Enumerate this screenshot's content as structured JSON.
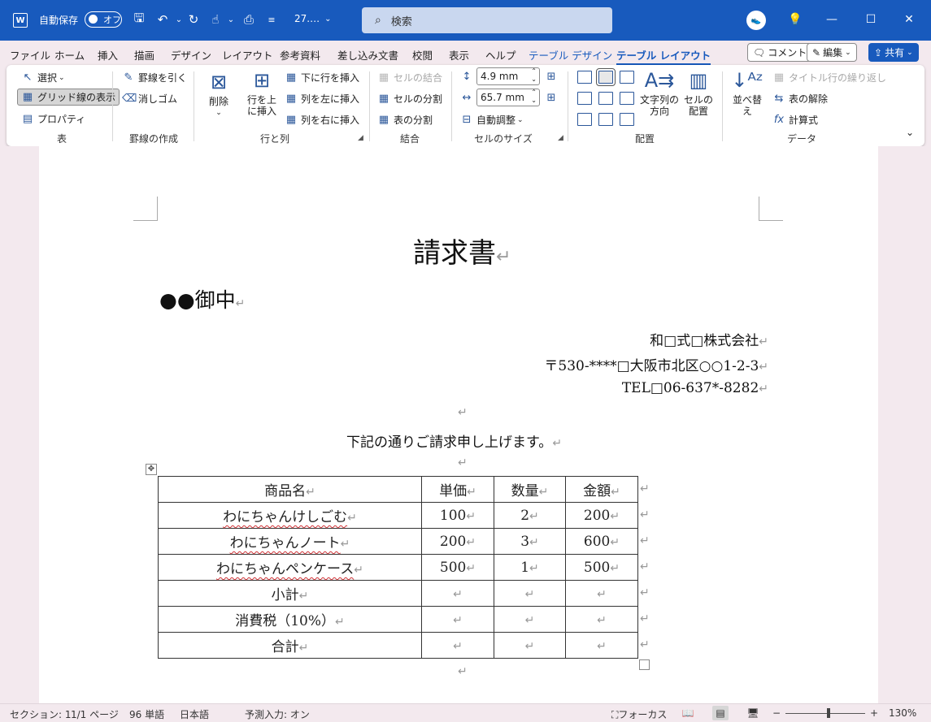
{
  "titlebar": {
    "app_logo": "W",
    "autosave_label": "自動保存",
    "autosave_state": "オフ",
    "doc_title": "27.…",
    "search_placeholder": "検索",
    "icons": [
      "save-icon",
      "undo-icon",
      "redo-icon",
      "touch-mode-icon",
      "customize-qat-icon"
    ]
  },
  "tabs": [
    {
      "label": "ファイル"
    },
    {
      "label": "ホーム"
    },
    {
      "label": "挿入"
    },
    {
      "label": "描画"
    },
    {
      "label": "デザイン"
    },
    {
      "label": "レイアウト"
    },
    {
      "label": "参考資料"
    },
    {
      "label": "差し込み文書"
    },
    {
      "label": "校閲"
    },
    {
      "label": "表示"
    },
    {
      "label": "ヘルプ"
    },
    {
      "label": "テーブル デザイン"
    },
    {
      "label": "テーブル レイアウト"
    }
  ],
  "top_buttons": {
    "comment": "コメント",
    "edit": "編集",
    "share": "共有"
  },
  "ribbon": {
    "table": {
      "select": "選択",
      "gridlines": "グリッド線の表示",
      "properties": "プロパティ",
      "label": "表"
    },
    "draw": {
      "draw_borders": "罫線を引く",
      "eraser": "消しゴム",
      "label": "罫線の作成"
    },
    "rows_cols": {
      "delete": "削除",
      "insert_above": "行を上\nに挿入",
      "insert_below": "下に行を挿入",
      "insert_left": "列を左に挿入",
      "insert_right": "列を右に挿入",
      "label": "行と列"
    },
    "merge": {
      "merge_cells": "セルの結合",
      "split_cells": "セルの分割",
      "split_table": "表の分割",
      "label": "結合"
    },
    "cell_size": {
      "height": "4.9 mm",
      "width": "65.7 mm",
      "autofit": "自動調整",
      "label": "セルのサイズ"
    },
    "alignment": {
      "text_direction": "文字列の\n方向",
      "cell_margins": "セルの\n配置",
      "label": "配置"
    },
    "data": {
      "sort": "並べ替え",
      "repeat_header": "タイトル行の繰り返し",
      "convert_to_text": "表の解除",
      "formula": "計算式",
      "label": "データ"
    }
  },
  "document": {
    "title": "請求書",
    "addressee": "●●御中",
    "company": "和□式□株式会社",
    "address": "〒530-****□大阪市北区○○1-2-3",
    "tel": "TEL□06-637*-8282",
    "intro": "下記の通りご請求申し上げます。",
    "paragraph_mark": "↵",
    "table": {
      "headers": [
        "商品名",
        "単価",
        "数量",
        "金額"
      ],
      "rows": [
        [
          "わにちゃんけしごむ",
          "100",
          "2",
          "200"
        ],
        [
          "わにちゃんノート",
          "200",
          "3",
          "600"
        ],
        [
          "わにちゃんペンケース",
          "500",
          "1",
          "500"
        ],
        [
          "小計",
          "",
          "",
          ""
        ],
        [
          "消費税（10%）",
          "",
          "",
          ""
        ],
        [
          "合計",
          "",
          "",
          ""
        ]
      ]
    }
  },
  "statusbar": {
    "section": "セクション: 1",
    "page": "1/1 ページ",
    "words": "96 単語",
    "language": "日本語",
    "predictive": "予測入力: オン",
    "focus": "フォーカス",
    "zoom": "130%",
    "zoom_minus": "−",
    "zoom_plus": "+"
  },
  "colors": {
    "titlebar": "#185abd",
    "accent": "#185abd",
    "spell_underline": "#d13438"
  }
}
